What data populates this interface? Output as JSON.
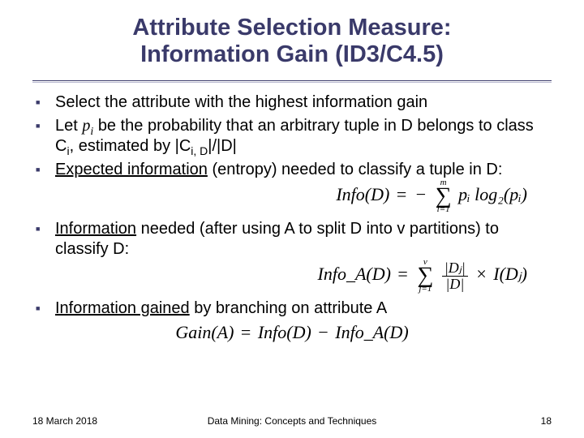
{
  "title": {
    "line1": "Attribute Selection Measure:",
    "line2": "Information Gain (ID3/C4.5)"
  },
  "bullets": {
    "b1": "Select the attribute with the highest information gain",
    "b2": {
      "a": "Let ",
      "p": "p",
      "i": "i",
      "b": " be the probability that an arbitrary tuple in D belongs to class C",
      "ci": "i",
      "c": ", estimated by |C",
      "cid": "i, D",
      "d": "|/|D|"
    },
    "b3": {
      "u": "Expected information",
      "rest": " (entropy) needed to classify a tuple in D:"
    },
    "b4": {
      "u": "Information",
      "rest": " needed (after using A to split D into v partitions) to classify D:"
    },
    "b5": {
      "u": "Information gained",
      "rest": " by branching on attribute A"
    }
  },
  "formulas": {
    "eq": "=",
    "minus": "−",
    "times": "×",
    "sigma": "∑",
    "info": {
      "lhs": "Info(D)",
      "stop": "m",
      "sbot": "i=1",
      "term": "pᵢ log₂(pᵢ)"
    },
    "infoA": {
      "lhs": "Info_A(D)",
      "stop": "v",
      "sbot": "j=1",
      "num": "|Dⱼ|",
      "den": "|D|",
      "tail": "I(Dⱼ)"
    },
    "gain": {
      "lhs": "Gain(A)",
      "a": "Info(D)",
      "b": "Info_A(D)"
    }
  },
  "footer": {
    "date": "18 March 2018",
    "center": "Data Mining: Concepts and Techniques",
    "page": "18"
  }
}
